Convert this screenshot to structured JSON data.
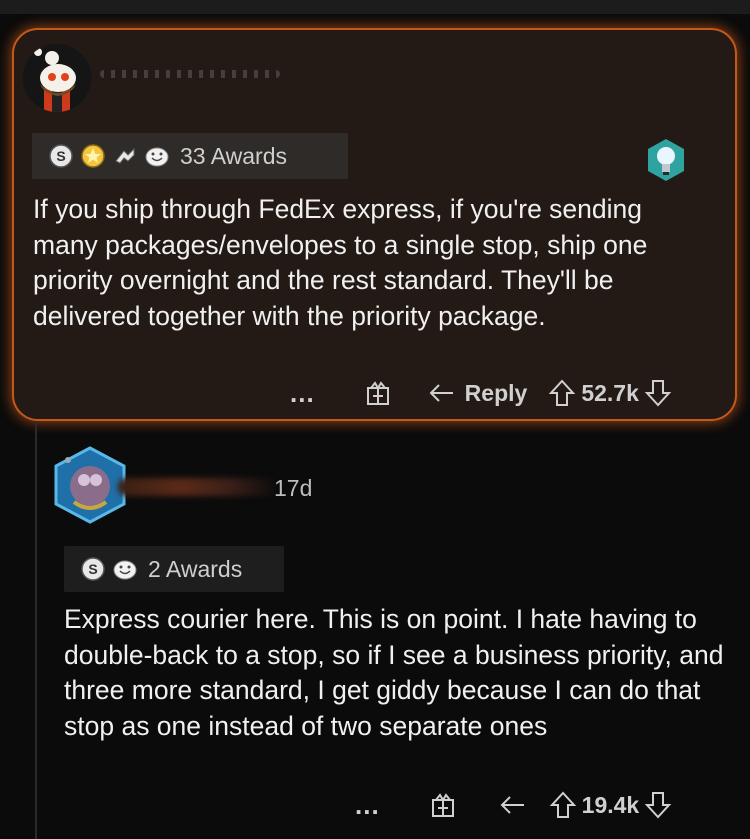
{
  "comment": {
    "awards_label": "33 Awards",
    "body": "If you ship through FedEx express, if you're sending many packages/envelopes to a single stop, ship one priority overnight and the rest standard.  They'll be delivered together with the priority package.",
    "more": "...",
    "reply_label": "Reply",
    "score": "52.7k",
    "icons": [
      "silver-award-icon",
      "gold-award-icon",
      "helpful-award-icon",
      "wholesome-award-icon",
      "lightbulb-flair-icon",
      "gift-icon",
      "reply-arrow-icon",
      "upvote-icon",
      "downvote-icon"
    ]
  },
  "reply": {
    "age": "17d",
    "awards_label": "2 Awards",
    "body": "Express courier here. This is on point. I hate having to double-back to a stop, so if I see a business priority, and three more standard, I get giddy because I can do that stop as one instead of two separate ones",
    "more": "...",
    "score": "19.4k",
    "icons": [
      "silver-award-icon",
      "wholesome-award-icon",
      "gift-icon",
      "reply-arrow-icon",
      "upvote-icon",
      "downvote-icon"
    ]
  },
  "colors": {
    "card_background": "#231a15",
    "card_border": "#c4581a",
    "page_background": "#0b0b0b",
    "text": "#f0f0f0"
  }
}
